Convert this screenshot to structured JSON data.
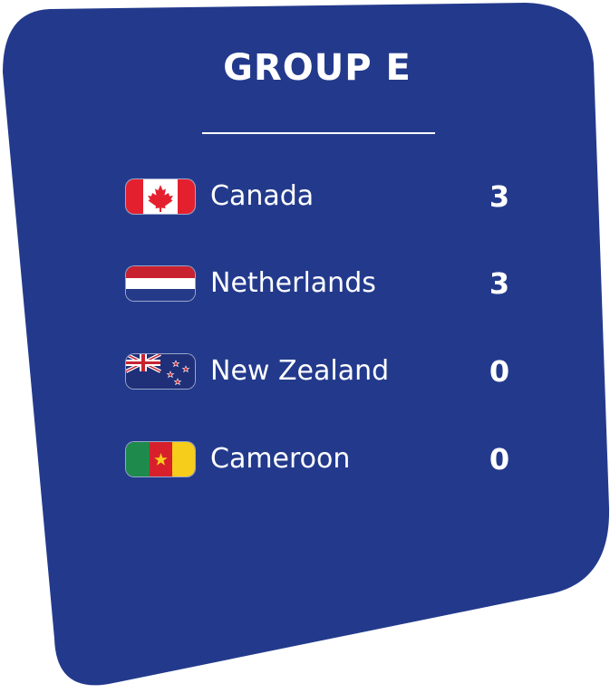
{
  "group_title": "GROUP E",
  "colors": {
    "card_background": "#233a8c",
    "text": "#ffffff"
  },
  "teams": [
    {
      "name": "Canada",
      "points": "3",
      "flag_icon": "canada-flag-icon"
    },
    {
      "name": "Netherlands",
      "points": "3",
      "flag_icon": "netherlands-flag-icon"
    },
    {
      "name": "New Zealand",
      "points": "0",
      "flag_icon": "new-zealand-flag-icon"
    },
    {
      "name": "Cameroon",
      "points": "0",
      "flag_icon": "cameroon-flag-icon"
    }
  ]
}
